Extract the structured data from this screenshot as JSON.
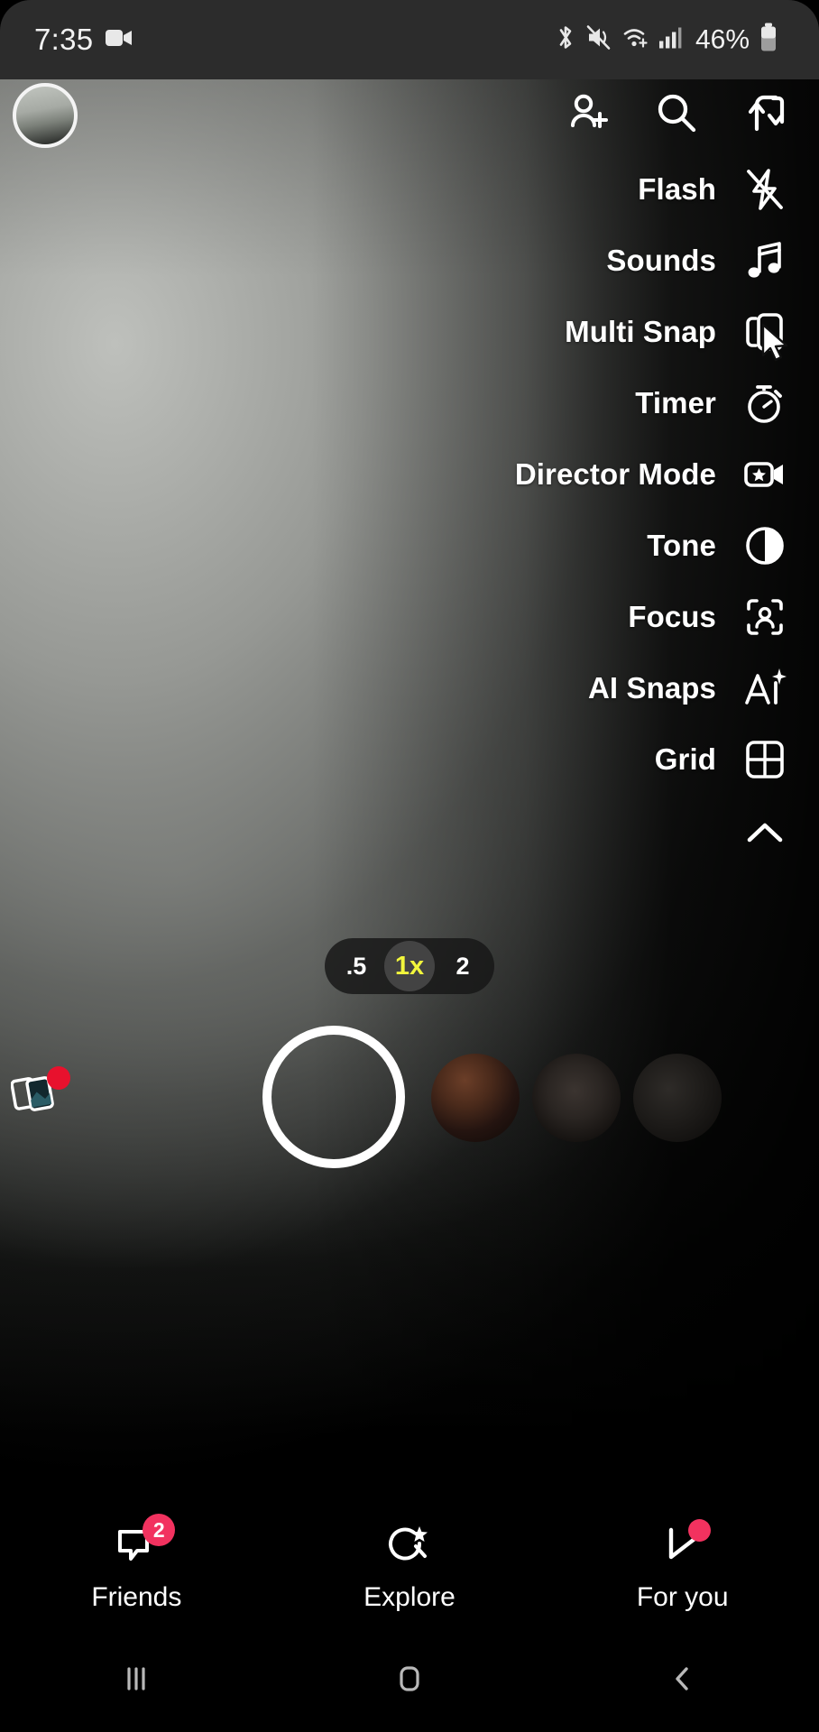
{
  "status_bar": {
    "time": "7:35",
    "recording_icon": "video-camera-icon",
    "icons": [
      "bluetooth-icon",
      "vibrate-mute-icon",
      "wifi-icon",
      "cellular-signal-icon"
    ],
    "battery_percent": "46%",
    "battery_icon": "battery-icon"
  },
  "top_bar": {
    "avatar": "profile-avatar",
    "actions": [
      {
        "name": "add-friend-icon",
        "label": "Add Friend"
      },
      {
        "name": "search-icon",
        "label": "Search"
      },
      {
        "name": "flip-camera-icon",
        "label": "Flip Camera"
      }
    ]
  },
  "camera_menu": {
    "items": [
      {
        "label": "Flash",
        "icon": "flash-off-icon"
      },
      {
        "label": "Sounds",
        "icon": "music-note-icon"
      },
      {
        "label": "Multi Snap",
        "icon": "multi-snap-icon"
      },
      {
        "label": "Timer",
        "icon": "stopwatch-icon"
      },
      {
        "label": "Director Mode",
        "icon": "video-star-icon"
      },
      {
        "label": "Tone",
        "icon": "contrast-circle-icon"
      },
      {
        "label": "Focus",
        "icon": "focus-person-icon"
      },
      {
        "label": "AI Snaps",
        "icon": "ai-sparkle-icon"
      },
      {
        "label": "Grid",
        "icon": "grid-four-icon"
      }
    ],
    "collapse_icon": "chevron-up-icon"
  },
  "zoom_selector": {
    "options": [
      {
        "value": ".5",
        "active": false
      },
      {
        "value": "1x",
        "active": true
      },
      {
        "value": "2",
        "active": false
      }
    ],
    "active_color": "#f2f63c"
  },
  "capture": {
    "shutter": "shutter-button",
    "memories_icon": "memories-icon",
    "memories_has_badge": true,
    "stories": [
      "story-thumbnail-1",
      "story-thumbnail-2",
      "story-thumbnail-3"
    ]
  },
  "bottom_nav": {
    "items": [
      {
        "label": "Friends",
        "icon": "chat-bubble-icon",
        "badge": "2",
        "dot": false
      },
      {
        "label": "Explore",
        "icon": "explore-star-icon",
        "badge": null,
        "dot": false
      },
      {
        "label": "For you",
        "icon": "spotlight-play-icon",
        "badge": null,
        "dot": true
      }
    ],
    "badge_color": "#f2325f"
  },
  "android_nav": {
    "buttons": [
      {
        "name": "recents-button",
        "icon": "recents-icon"
      },
      {
        "name": "home-button",
        "icon": "home-icon"
      },
      {
        "name": "back-button",
        "icon": "back-icon"
      }
    ]
  }
}
